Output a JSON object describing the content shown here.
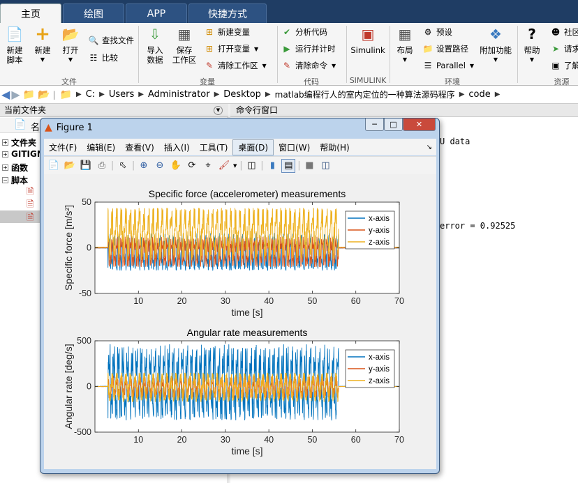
{
  "tabs": [
    {
      "label": "主页",
      "active": true
    },
    {
      "label": "绘图",
      "active": false
    },
    {
      "label": "APP",
      "active": false
    },
    {
      "label": "快捷方式",
      "active": false
    }
  ],
  "ribbon": {
    "file_group": "文件",
    "var_group": "变量",
    "code_group": "代码",
    "simulink_group": "SIMULINK",
    "env_group": "环境",
    "res_group": "资源",
    "new_script": "新建\n脚本",
    "new": "新建",
    "open": "打开",
    "find_files": "查找文件",
    "compare": "比较",
    "import_data": "导入\n数据",
    "save_workspace": "保存\n工作区",
    "new_variable": "新建变量",
    "open_variable": "打开变量",
    "clear_workspace": "清除工作区",
    "analyze_code": "分析代码",
    "run_and_time": "运行并计时",
    "clear_commands": "清除命令",
    "simulink": "Simulink",
    "layout": "布局",
    "preferences": "预设",
    "set_path": "设置路径",
    "parallel": "Parallel",
    "addons": "附加功能",
    "help": "帮助",
    "community": "社区",
    "request_support": "请求",
    "learn": "了解"
  },
  "address": {
    "crumbs": [
      "C:",
      "Users",
      "Administrator",
      "Desktop",
      "matlab编程行人的室内定位的一种算法源码程序",
      "code"
    ]
  },
  "left_panel": {
    "title": "当前文件夹",
    "col_header": "名",
    "items": [
      "文件夹",
      "GITIGN",
      "函数",
      "脚本"
    ]
  },
  "command_window": {
    "title": "命令行窗口",
    "lines": [
      "U data",
      "error = 0.92525"
    ]
  },
  "figure": {
    "title": "Figure 1",
    "menu": [
      "文件(F)",
      "编辑(E)",
      "查看(V)",
      "插入(I)",
      "工具(T)",
      "桌面(D)",
      "窗口(W)",
      "帮助(H)"
    ],
    "selected_menu": "桌面(D)"
  },
  "chart_data": [
    {
      "type": "line",
      "title": "Specific force (accelerometer) measurements",
      "xlabel": "time [s]",
      "ylabel": "Specific force [m/s²]",
      "xlim": [
        0,
        70
      ],
      "ylim": [
        -50,
        50
      ],
      "xticks": [
        10,
        20,
        30,
        40,
        50,
        60,
        70
      ],
      "yticks": [
        -50,
        0,
        50
      ],
      "grid": false,
      "legend": "top-right",
      "signal_span": [
        3,
        56
      ],
      "series": [
        {
          "name": "x-axis",
          "color": "#0072bd",
          "approx_range": [
            -25,
            15
          ]
        },
        {
          "name": "y-axis",
          "color": "#d95319",
          "approx_range": [
            -20,
            12
          ]
        },
        {
          "name": "z-axis",
          "color": "#edb120",
          "approx_range": [
            -12,
            42
          ]
        }
      ]
    },
    {
      "type": "line",
      "title": "Angular rate measurements",
      "xlabel": "time [s]",
      "ylabel": "Angular rate  [deg/s]",
      "xlim": [
        0,
        70
      ],
      "ylim": [
        -500,
        500
      ],
      "xticks": [
        10,
        20,
        30,
        40,
        50,
        60,
        70
      ],
      "yticks": [
        -500,
        0,
        500
      ],
      "grid": false,
      "legend": "top-right",
      "signal_span": [
        3,
        56
      ],
      "series": [
        {
          "name": "x-axis",
          "color": "#0072bd",
          "approx_range": [
            -370,
            440
          ]
        },
        {
          "name": "y-axis",
          "color": "#d95319",
          "approx_range": [
            -120,
            110
          ]
        },
        {
          "name": "z-axis",
          "color": "#edb120",
          "approx_range": [
            -160,
            140
          ]
        }
      ]
    }
  ]
}
